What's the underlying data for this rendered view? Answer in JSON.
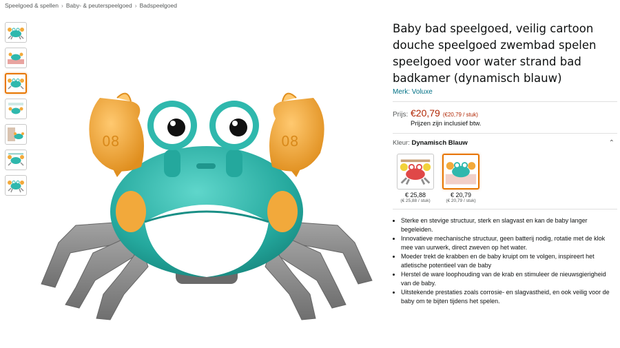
{
  "breadcrumb": [
    "Speelgoed & spellen",
    "Baby- & peuterspeelgoed",
    "Badspeelgoed"
  ],
  "breadcrumb_separator": "›",
  "thumbnails": [
    "crab-teal",
    "crab-teal-boxes",
    "crab-teal-selected",
    "crab-feature",
    "crab-with-baby",
    "crab-teal-side",
    "crab-teal-front"
  ],
  "product": {
    "title": "Baby bad speelgoed, veilig cartoon douche speelgoed zwembad spelen speelgoed voor water strand bad badkamer (dynamisch blauw)",
    "brand": "Merk: Voluxe",
    "price_label": "Prijs:",
    "price": "€20,79",
    "price_unit": "(€20,79 / stuk)",
    "price_note": "Prijzen zijn inclusief btw."
  },
  "color": {
    "label": "Kleur:",
    "value": "Dynamisch Blauw",
    "options": [
      {
        "price": "€ 25,88",
        "unit": "(€ 25,88 / stuk)",
        "image": "crab-red"
      },
      {
        "price": "€ 20,79",
        "unit": "(€ 20,79 / stuk)",
        "image": "crab-teal"
      }
    ]
  },
  "bullets": [
    "Sterke en stevige structuur, sterk en slagvast en kan de baby langer begeleiden.",
    "Innovatieve mechanische structuur, geen batterij nodig, rotatie met de klok mee van uurwerk, direct zweven op het water.",
    "Moeder trekt de krabben en de baby kruipt om te volgen, inspireert het atletische potentieel van de baby",
    "Herstel de ware loophouding van de krab en stimuleer de nieuwsgierigheid van de baby.",
    "Uitstekende prestaties zoals corrosie- en slagvastheid, en ook veilig voor de baby om te bijten tijdens het spelen."
  ],
  "colors": {
    "accent": "#e77600",
    "link": "#007185",
    "price": "#b12704",
    "crab_body": "#2fb8ad",
    "crab_claw": "#f2a93b",
    "crab_legs": "#8d8d8d"
  }
}
